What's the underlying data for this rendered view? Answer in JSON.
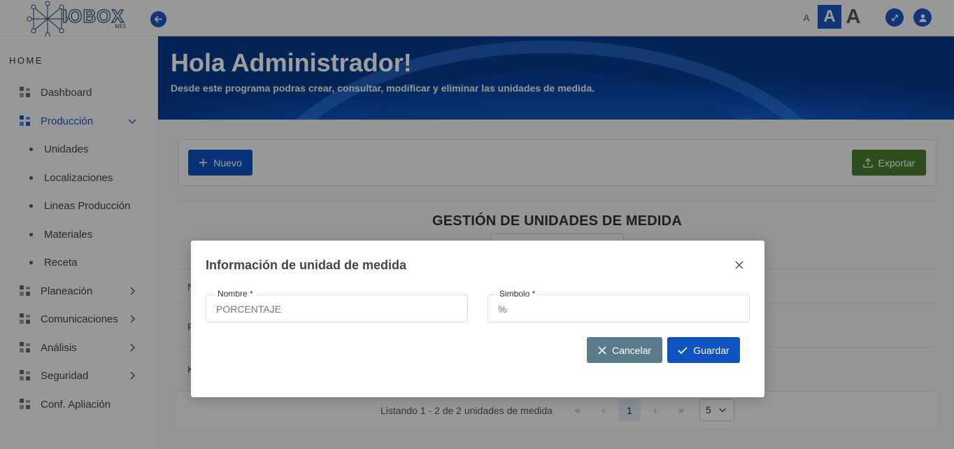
{
  "app": {
    "logo_text": "IOBOX",
    "logo_sub": "MES"
  },
  "topbar": {
    "font_small": "A",
    "font_medium": "A",
    "font_large": "A"
  },
  "sidebar": {
    "section_label": "HOME",
    "items": [
      {
        "label": "Dashboard"
      },
      {
        "label": "Producción",
        "sub": [
          "Unidades",
          "Localizaciones",
          "Lineas Producción",
          "Materiales",
          "Receta"
        ]
      },
      {
        "label": "Planeación"
      },
      {
        "label": "Comunicaciones"
      },
      {
        "label": "Análisis"
      },
      {
        "label": "Seguridad"
      },
      {
        "label": "Conf. Apliación"
      }
    ]
  },
  "banner": {
    "title": "Hola Administrador!",
    "subtitle": "Desde este programa podras crear, consultar, modificar y eliminar las unidades de medida."
  },
  "toolbar": {
    "new_label": "Nuevo",
    "export_label": "Exportar"
  },
  "table": {
    "title": "GESTIÓN DE UNIDADES DE MEDIDA",
    "header_first_letter": "N",
    "rows": [
      {
        "first_letter": "P"
      },
      {
        "first_letter": "K"
      }
    ],
    "pagination": {
      "summary": "Listando 1 - 2 de 2 unidades de medida",
      "current_page": "1",
      "page_size": "5"
    }
  },
  "dialog": {
    "title": "Información de unidad de medida",
    "fields": {
      "name_label": "Nombre *",
      "name_value": "PORCENTAJE",
      "symbol_label": "Simbolo *",
      "symbol_value": "%"
    },
    "cancel_label": "Cancelar",
    "save_label": "Guardar"
  },
  "colors": {
    "primary": "#0f52c0",
    "export_green": "#4b7d33",
    "cancel_gray": "#5b7a8a",
    "banner_blue": "#0a4fb5"
  }
}
